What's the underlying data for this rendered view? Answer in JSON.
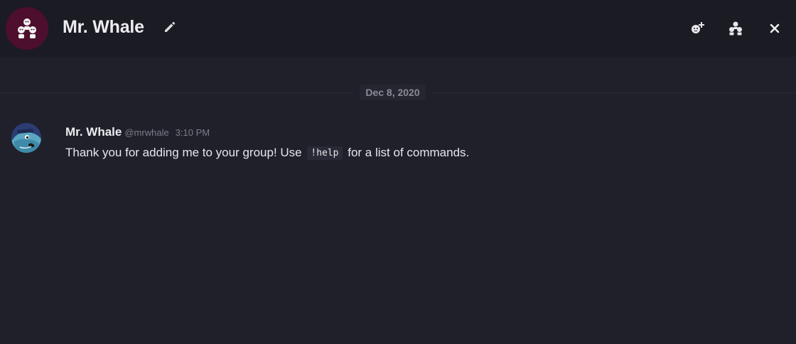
{
  "header": {
    "title": "Mr. Whale",
    "group_avatar_icon": "group-users-icon",
    "edit_icon": "pencil-icon",
    "actions": [
      {
        "icon": "add-user-icon"
      },
      {
        "icon": "members-icon"
      },
      {
        "icon": "close-icon"
      }
    ]
  },
  "conversation": {
    "date_separator": "Dec 8, 2020",
    "messages": [
      {
        "author": "Mr. Whale",
        "handle": "@mrwhale",
        "time": "3:10 PM",
        "text_before": "Thank you for adding me to your group! Use",
        "code": "!help",
        "text_after": "for a list of commands."
      }
    ]
  },
  "colors": {
    "background": "#20202b",
    "header_background": "#1b1b24",
    "group_avatar": "#4e0e2d",
    "muted_text": "#7d7d88"
  }
}
